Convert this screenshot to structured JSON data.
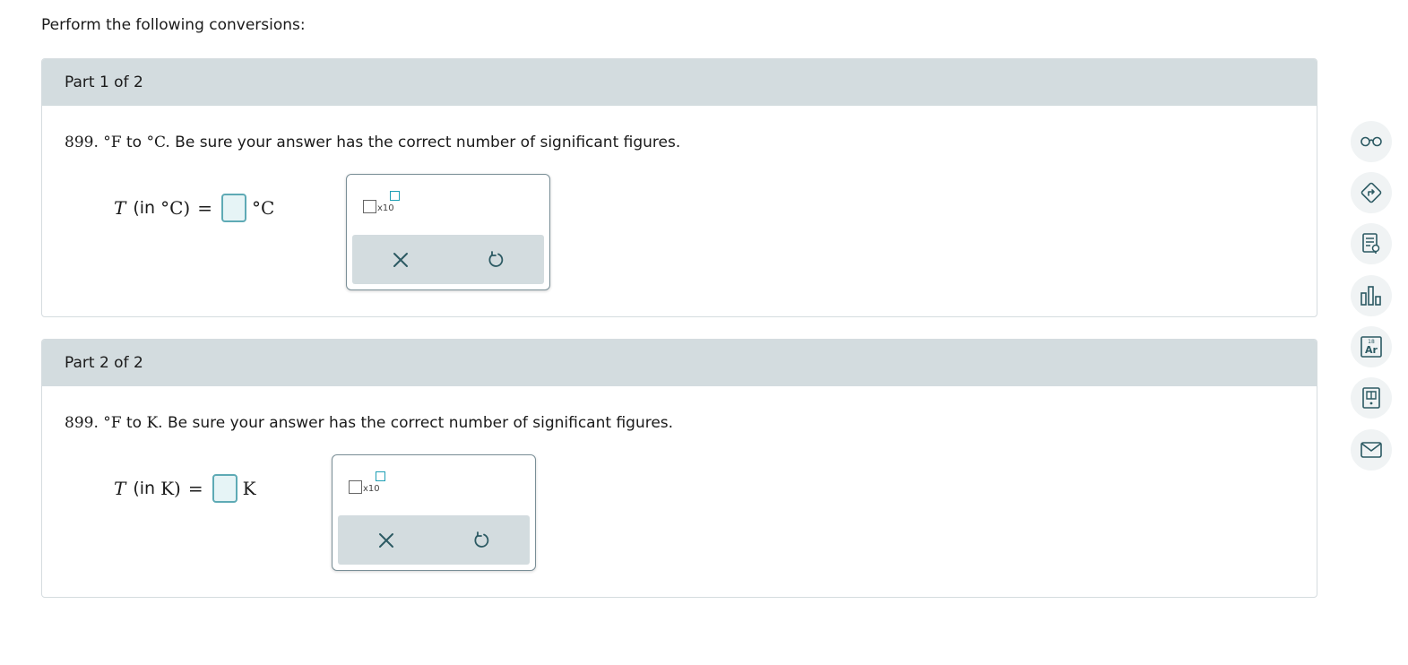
{
  "intro": "Perform the following conversions:",
  "parts": [
    {
      "header": "Part 1 of 2",
      "question": {
        "number": "899.",
        "from_unit": "°F",
        "to_word": "to",
        "to_unit": "°C.",
        "instruction": "Be sure your answer has the correct number of significant figures."
      },
      "equation": {
        "var": "T",
        "label_open": "(in",
        "unit_serif": "°C)",
        "equals": "=",
        "answer_value": "",
        "unit_after": "°C"
      },
      "palette": {
        "x10_label": "x10"
      }
    },
    {
      "header": "Part 2 of 2",
      "question": {
        "number": "899.",
        "from_unit": "°F",
        "to_word": "to",
        "to_unit": "K.",
        "instruction": "Be sure your answer has the correct number of significant figures."
      },
      "equation": {
        "var": "T",
        "label_open": "(in",
        "unit_serif": "K)",
        "equals": "=",
        "answer_value": "",
        "unit_after": "K"
      },
      "palette": {
        "x10_label": "x10"
      }
    }
  ],
  "sidebar_icons": [
    "glasses-icon",
    "directions-icon",
    "worksheet-icon",
    "bar-chart-icon",
    "periodic-table-icon",
    "textbook-icon",
    "mail-icon"
  ],
  "periodic_tile": {
    "number": "18",
    "symbol": "Ar"
  },
  "colors": {
    "accent": "#1f9fb5",
    "header_bg": "#d3dcdf",
    "icon": "#2c5a63"
  }
}
